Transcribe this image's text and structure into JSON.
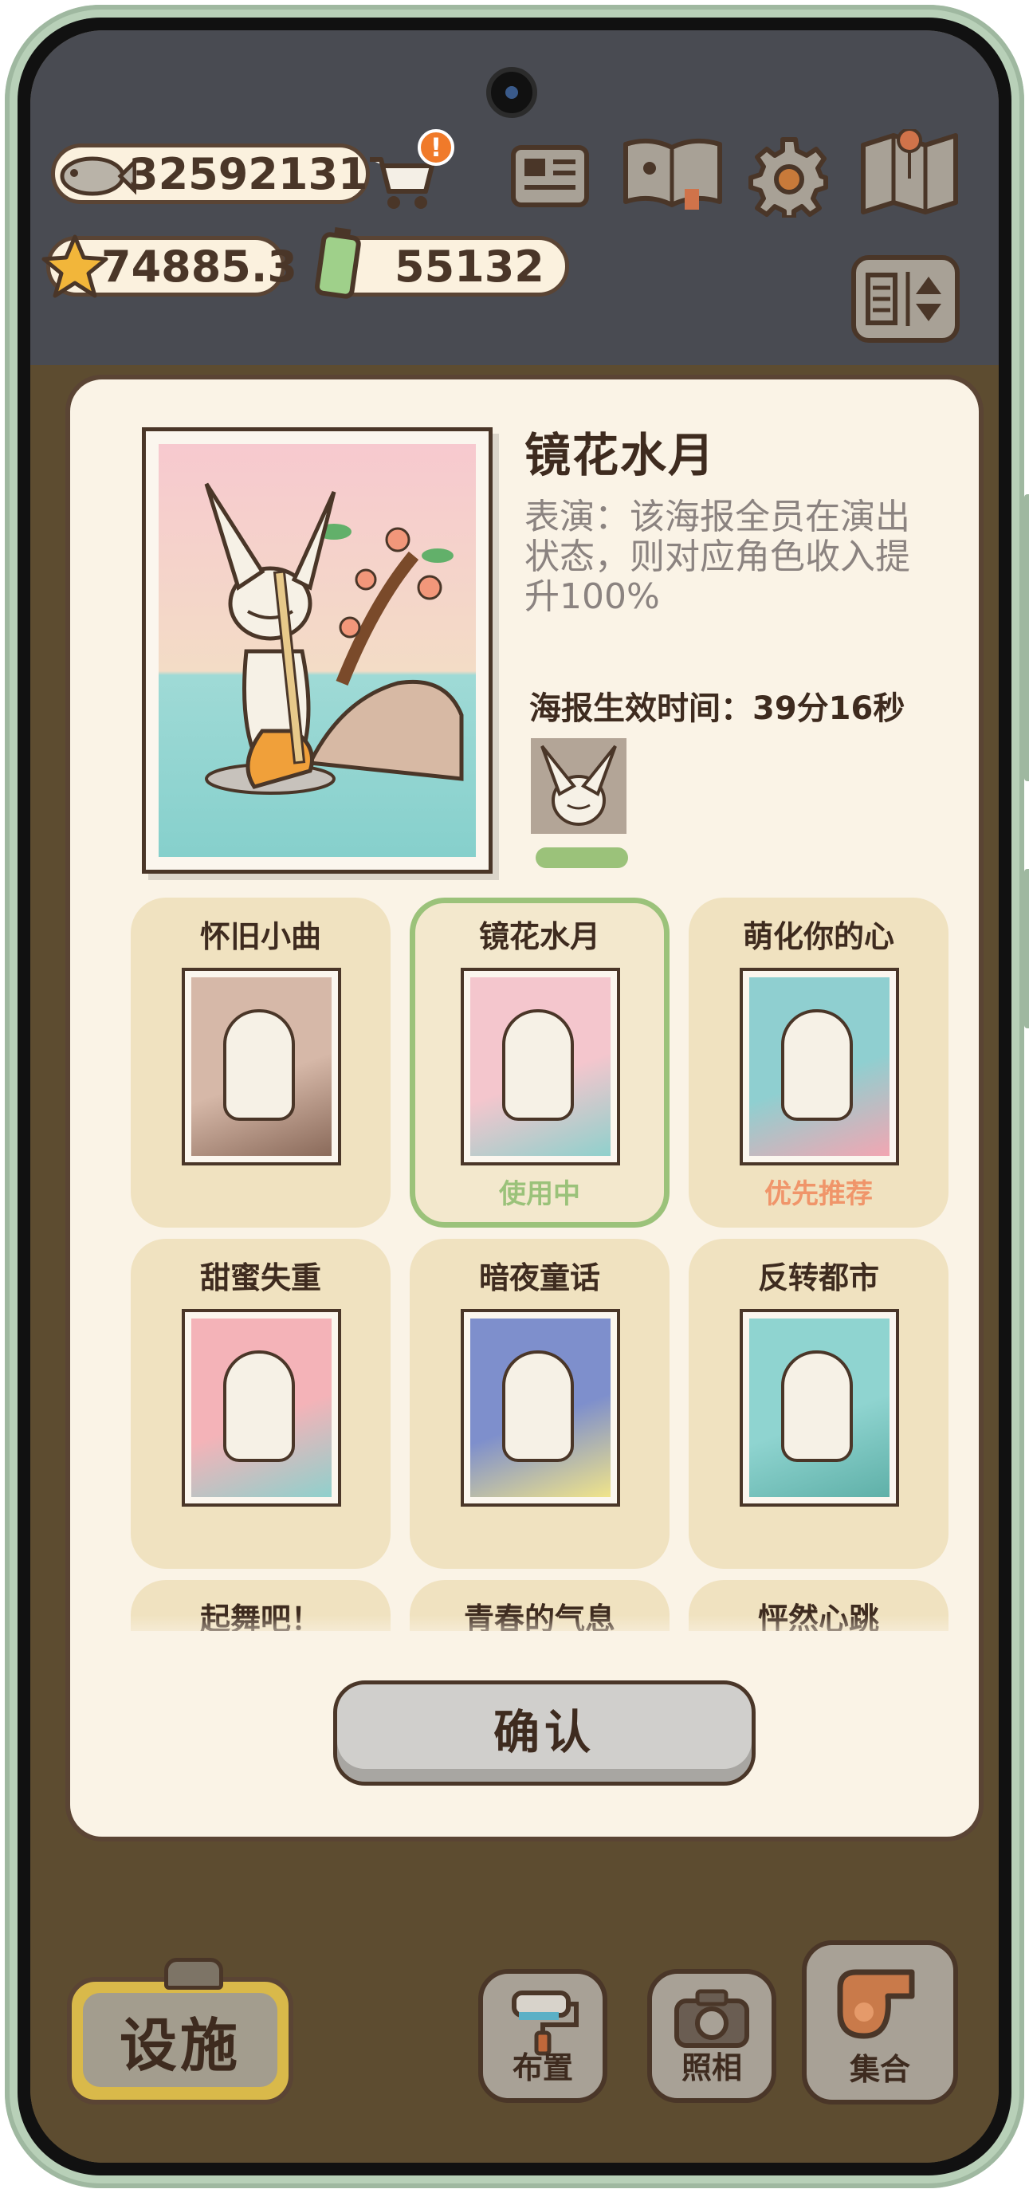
{
  "currencies": {
    "fish": "32592131",
    "stars": "74885.3",
    "battery": "55132",
    "cart_badge": "!"
  },
  "top_icons": [
    "newspaper-icon",
    "album-book-icon",
    "gear-icon",
    "map-icon",
    "sort-toggle-icon"
  ],
  "dialog": {
    "title": "镜花水月",
    "description": "表演：该海报全员在演出状态，则对应角色收入提升100%",
    "timer_label": "海报生效时间：39分16秒",
    "confirm": "确认"
  },
  "posters": [
    {
      "title": "怀旧小曲",
      "status": "",
      "colors": [
        "#d6b8a8",
        "#8a6a5a"
      ]
    },
    {
      "title": "镜花水月",
      "status": "使用中",
      "status_color": "#9bc27a",
      "selected": true,
      "colors": [
        "#f4c6cd",
        "#8fd0cc"
      ]
    },
    {
      "title": "萌化你的心",
      "status": "优先推荐",
      "status_color": "#f0956a",
      "colors": [
        "#8fcfd0",
        "#f2a6b2"
      ]
    },
    {
      "title": "甜蜜失重",
      "status": "",
      "colors": [
        "#f4b3b8",
        "#8fd0cc"
      ]
    },
    {
      "title": "暗夜童话",
      "status": "",
      "colors": [
        "#7e8fcc",
        "#f0e48a"
      ]
    },
    {
      "title": "反转都市",
      "status": "",
      "colors": [
        "#8fd4d0",
        "#5fb0a8"
      ]
    },
    {
      "title": "起舞吧！",
      "status": ""
    },
    {
      "title": "青春的气息",
      "status": ""
    },
    {
      "title": "怦然心跳",
      "status": ""
    }
  ],
  "bottom_bar": {
    "facility": "设施",
    "layout": "布置",
    "photo": "照相",
    "gather": "集合"
  }
}
